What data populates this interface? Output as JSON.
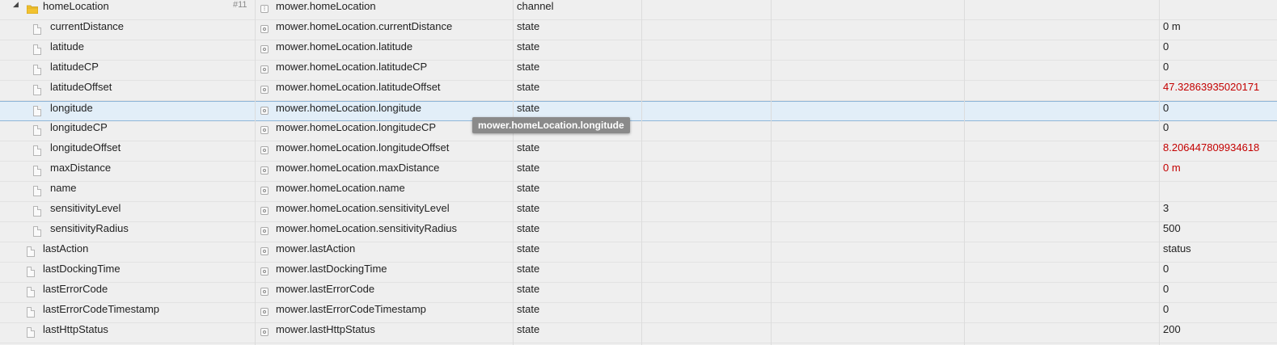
{
  "rows": [
    {
      "name": "homeLocation",
      "count": "#11",
      "id": "mower.homeLocation",
      "type": "channel",
      "value": ""
    },
    {
      "name": "currentDistance",
      "id": "mower.homeLocation.currentDistance",
      "type": "state",
      "value": "0 m"
    },
    {
      "name": "latitude",
      "id": "mower.homeLocation.latitude",
      "type": "state",
      "value": "0"
    },
    {
      "name": "latitudeCP",
      "id": "mower.homeLocation.latitudeCP",
      "type": "state",
      "value": "0"
    },
    {
      "name": "latitudeOffset",
      "id": "mower.homeLocation.latitudeOffset",
      "type": "state",
      "value": "47.32863935020171"
    },
    {
      "name": "longitude",
      "id": "mower.homeLocation.longitude",
      "type": "state",
      "value": "0"
    },
    {
      "name": "longitudeCP",
      "id": "mower.homeLocation.longitudeCP",
      "type": "state",
      "value": "0"
    },
    {
      "name": "longitudeOffset",
      "id": "mower.homeLocation.longitudeOffset",
      "type": "state",
      "value": "8.206447809934618"
    },
    {
      "name": "maxDistance",
      "id": "mower.homeLocation.maxDistance",
      "type": "state",
      "value": "0 m"
    },
    {
      "name": "name",
      "id": "mower.homeLocation.name",
      "type": "state",
      "value": ""
    },
    {
      "name": "sensitivityLevel",
      "id": "mower.homeLocation.sensitivityLevel",
      "type": "state",
      "value": "3"
    },
    {
      "name": "sensitivityRadius",
      "id": "mower.homeLocation.sensitivityRadius",
      "type": "state",
      "value": "500"
    },
    {
      "name": "lastAction",
      "id": "mower.lastAction",
      "type": "state",
      "value": "status"
    },
    {
      "name": "lastDockingTime",
      "id": "mower.lastDockingTime",
      "type": "state",
      "value": "0"
    },
    {
      "name": "lastErrorCode",
      "id": "mower.lastErrorCode",
      "type": "state",
      "value": "0"
    },
    {
      "name": "lastErrorCodeTimestamp",
      "id": "mower.lastErrorCodeTimestamp",
      "type": "state",
      "value": "0"
    },
    {
      "name": "lastHttpStatus",
      "id": "mower.lastHttpStatus",
      "type": "state",
      "value": "200"
    }
  ],
  "tooltip": {
    "text": "mower.homeLocation.longitude"
  },
  "icons": {
    "toggle": "triangle-down-icon",
    "folder": "folder-icon",
    "file": "file-icon",
    "state": "state-icon",
    "channel": "channel-icon"
  },
  "colors": {
    "highlight_value": "#c40000",
    "selected_row": "#e2eef8",
    "folder": "#f2c230"
  }
}
